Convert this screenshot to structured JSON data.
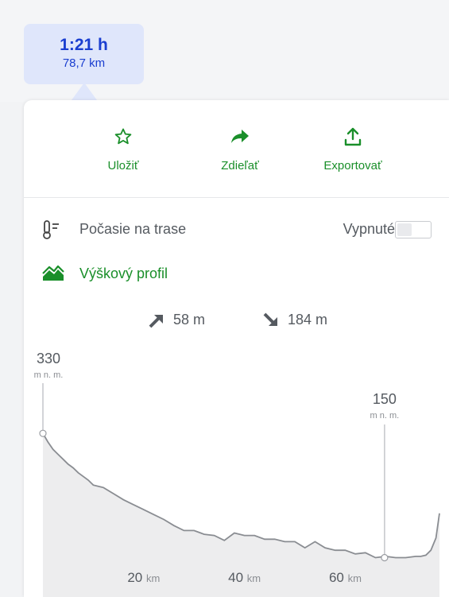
{
  "route": {
    "time": "1:21 h",
    "distance": "78,7 km"
  },
  "actions": [
    {
      "label": "Uložiť",
      "icon": "star-icon"
    },
    {
      "label": "Zdieľať",
      "icon": "share-arrow-icon"
    },
    {
      "label": "Exportovať",
      "icon": "export-upload-icon"
    }
  ],
  "weather": {
    "label": "Počasie na trase",
    "state": "Vypnuté",
    "toggle_on": false,
    "icon": "thermometer-icon"
  },
  "elevation": {
    "label": "Výškový profil",
    "icon": "mountain-icon",
    "ascent": "58 m",
    "descent": "184 m",
    "max_value": "330",
    "max_unit": "m n. m.",
    "end_value": "150",
    "end_unit": "m n. m."
  },
  "chart_data": {
    "type": "area",
    "x_tick_labels": [
      {
        "value": "20",
        "unit": "km"
      },
      {
        "value": "40",
        "unit": "km"
      },
      {
        "value": "60",
        "unit": "km"
      }
    ],
    "x_ticks_km": [
      20,
      40,
      60
    ],
    "xlim": [
      0,
      78.7
    ],
    "ylim": [
      130,
      340
    ],
    "grid": true,
    "profile": {
      "x": [
        0,
        1,
        2,
        3,
        4,
        5,
        6,
        7,
        8,
        9,
        10,
        12,
        14,
        16,
        18,
        20,
        22,
        24,
        26,
        28,
        30,
        32,
        34,
        36,
        38,
        40,
        42,
        44,
        46,
        48,
        50,
        52,
        54,
        56,
        58,
        60,
        62,
        64,
        66,
        68,
        70,
        72,
        74,
        75,
        76,
        77,
        78,
        78.7
      ],
      "y": [
        263,
        256,
        250,
        246,
        242,
        238,
        235,
        231,
        228,
        225,
        221,
        219,
        214,
        209,
        205,
        201,
        197,
        193,
        188,
        184,
        184,
        181,
        180,
        176,
        182,
        180,
        180,
        177,
        177,
        175,
        175,
        170,
        175,
        170,
        168,
        168,
        165,
        166,
        162,
        163,
        162,
        162,
        163,
        163,
        164,
        168,
        178,
        198
      ]
    },
    "max_marker": {
      "x": 0,
      "y": 263
    },
    "end_marker": {
      "x": 67.8,
      "y": 162
    }
  }
}
